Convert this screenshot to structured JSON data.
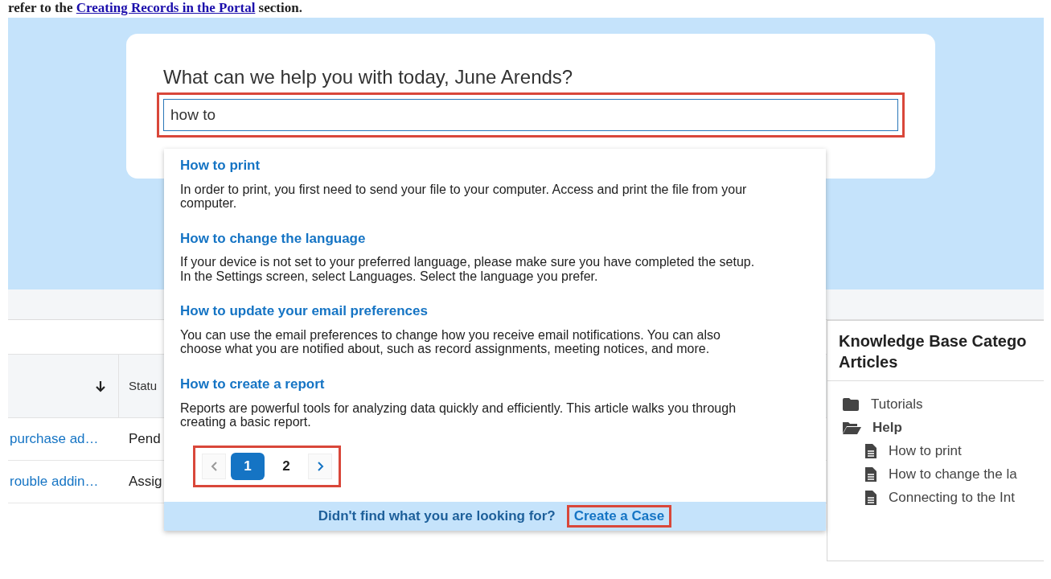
{
  "doc_text": {
    "prefix": "refer to the ",
    "link": "Creating Records in the Portal",
    "suffix": " section."
  },
  "search": {
    "heading": "What can we help you with today, June Arends?",
    "value": "how to"
  },
  "results": [
    {
      "title": "How to print",
      "snippet": "In order to print, you first need to send your file to your computer. Access and print the file from your computer."
    },
    {
      "title": "How to change the language",
      "snippet": "If your device is not set to your preferred language, please make sure you have completed the setup. In the Settings screen, select Languages. Select the language you prefer."
    },
    {
      "title": "How to update your email preferences",
      "snippet": "You can use the email preferences to change how you receive email notifications. You can also choose what you are notified about, such as record assignments, meeting notices, and more."
    },
    {
      "title": "How to create a report",
      "snippet": "Reports are powerful tools for analyzing data quickly and efficiently. This article walks you through creating a basic report."
    }
  ],
  "pagination": {
    "prev_disabled": true,
    "next_disabled": false,
    "pages": [
      {
        "label": "1",
        "selected": true
      },
      {
        "label": "2",
        "selected": false
      }
    ]
  },
  "footer": {
    "question": "Didn't find what you are looking for?",
    "link": "Create a Case"
  },
  "table": {
    "columns": [
      {
        "sorted": true
      },
      {
        "label": "Statu"
      }
    ],
    "rows": [
      {
        "subject": "purchase ad…",
        "status": "Pend"
      },
      {
        "subject": "rouble addin…",
        "status": "Assig"
      }
    ]
  },
  "kb_panel": {
    "title_lines": [
      "Knowledge Base Catego",
      "Articles"
    ],
    "tree": [
      {
        "kind": "folder",
        "label": "Tutorials",
        "expanded": false
      },
      {
        "kind": "folder",
        "label": "Help",
        "expanded": true,
        "children": [
          {
            "kind": "article",
            "label": "How to print"
          },
          {
            "kind": "article",
            "label": "How to change the la"
          },
          {
            "kind": "article",
            "label": "Connecting to the Int"
          }
        ]
      }
    ]
  }
}
